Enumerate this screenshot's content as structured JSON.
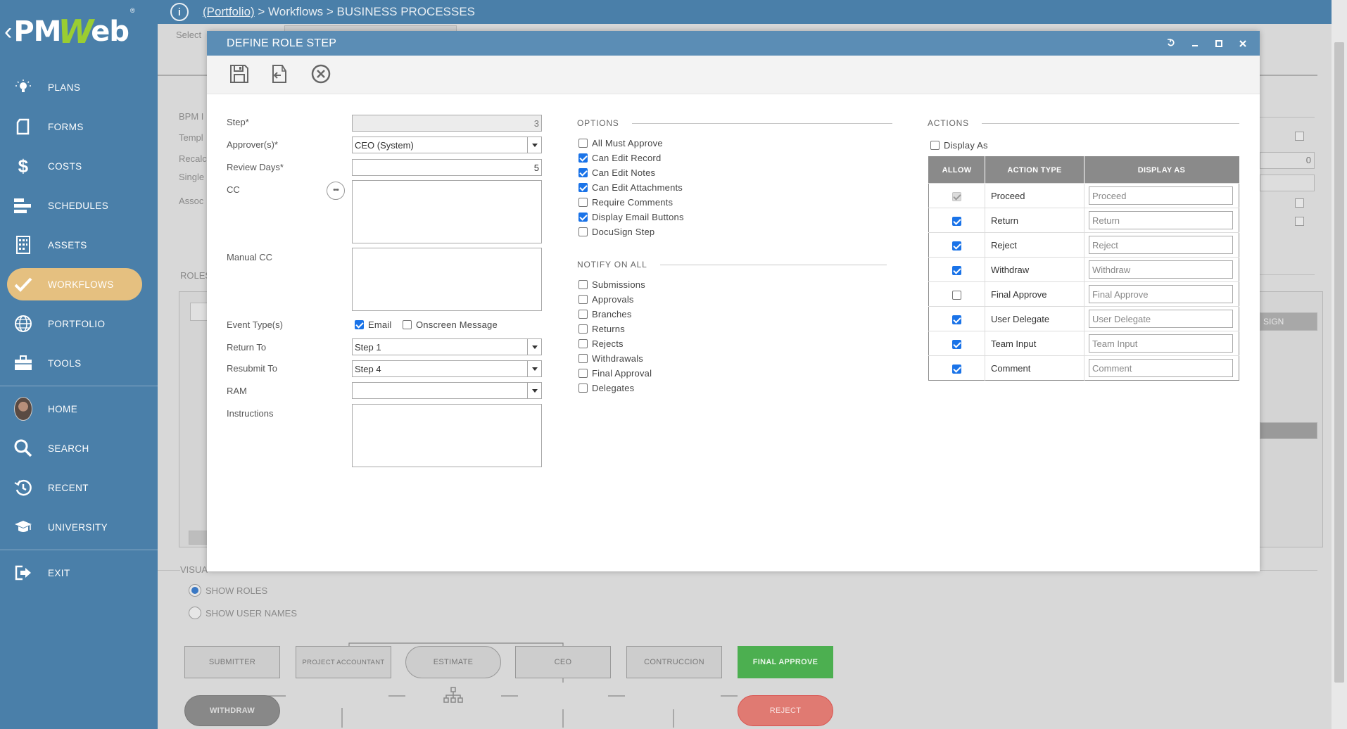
{
  "app": {
    "logo_text_left": "PM",
    "logo_text_mid": "W",
    "logo_text_right": "eb",
    "logo_reg": "®"
  },
  "sidebar": {
    "items": [
      {
        "label": "PLANS",
        "icon": "lightbulb-icon"
      },
      {
        "label": "FORMS",
        "icon": "document-icon"
      },
      {
        "label": "COSTS",
        "icon": "dollar-icon"
      },
      {
        "label": "SCHEDULES",
        "icon": "schedule-bars-icon"
      },
      {
        "label": "ASSETS",
        "icon": "building-icon"
      },
      {
        "label": "WORKFLOWS",
        "icon": "checkmark-icon",
        "active": true
      },
      {
        "label": "PORTFOLIO",
        "icon": "globe-icon"
      },
      {
        "label": "TOOLS",
        "icon": "briefcase-icon"
      },
      {
        "label": "HOME",
        "icon": "avatar"
      },
      {
        "label": "SEARCH",
        "icon": "search-icon"
      },
      {
        "label": "RECENT",
        "icon": "history-icon"
      },
      {
        "label": "UNIVERSITY",
        "icon": "graduation-cap-icon"
      },
      {
        "label": "EXIT",
        "icon": "exit-icon"
      }
    ],
    "active_color": "#e5c080",
    "bg_color": "#4a7fa9"
  },
  "topbar": {
    "portfolio_link": "(Portfolio)",
    "crumb_rest": " > Workflows > BUSINESS PROCESSES"
  },
  "background": {
    "select_label": "Select",
    "bpm_label": "BPM I",
    "templ_label": "Templ",
    "recalc_label": "Recalc",
    "single_label": "Single",
    "assoc_label": "Assoc",
    "roles_label": "ROLES",
    "visual_label": "VISUA",
    "right_value": "0",
    "sign_header": "SIGN",
    "show_roles": "SHOW ROLES",
    "show_user_names": "SHOW USER NAMES",
    "workflow": {
      "submitter": "SUBMITTER",
      "project_accountant": "PROJECT ACCOUNTANT",
      "estimate": "ESTIMATE",
      "ceo": "CEO",
      "contruccion": "CONTRUCCION",
      "final_approve": "FINAL APPROVE",
      "withdraw": "WITHDRAW",
      "reject": "REJECT"
    }
  },
  "modal": {
    "title": "DEFINE ROLE STEP",
    "form": {
      "step_label": "Step*",
      "step_value": "3",
      "approvers_label": "Approver(s)*",
      "approvers_value": "CEO (System)",
      "review_days_label": "Review Days*",
      "review_days_value": "5",
      "cc_label": "CC",
      "cc_button": "•••",
      "manual_cc_label": "Manual CC",
      "event_types_label": "Event Type(s)",
      "event_email": "Email",
      "event_onscreen": "Onscreen Message",
      "return_to_label": "Return To",
      "return_to_value": "Step 1",
      "resubmit_to_label": "Resubmit To",
      "resubmit_to_value": "Step 4",
      "ram_label": "RAM",
      "ram_value": "",
      "instructions_label": "Instructions"
    },
    "options": {
      "title": "OPTIONS",
      "items": [
        {
          "label": "All Must Approve",
          "checked": false
        },
        {
          "label": "Can Edit Record",
          "checked": true
        },
        {
          "label": "Can Edit Notes",
          "checked": true
        },
        {
          "label": "Can Edit Attachments",
          "checked": true
        },
        {
          "label": "Require Comments",
          "checked": false
        },
        {
          "label": "Display Email Buttons",
          "checked": true
        },
        {
          "label": "DocuSign Step",
          "checked": false
        }
      ]
    },
    "notify": {
      "title": "NOTIFY ON ALL",
      "items": [
        {
          "label": "Submissions",
          "checked": false
        },
        {
          "label": "Approvals",
          "checked": false
        },
        {
          "label": "Branches",
          "checked": false
        },
        {
          "label": "Returns",
          "checked": false
        },
        {
          "label": "Rejects",
          "checked": false
        },
        {
          "label": "Withdrawals",
          "checked": false
        },
        {
          "label": "Final Approval",
          "checked": false
        },
        {
          "label": "Delegates",
          "checked": false
        }
      ]
    },
    "actions": {
      "title": "ACTIONS",
      "display_as_label": "Display As",
      "columns": [
        "ALLOW",
        "ACTION TYPE",
        "DISPLAY AS"
      ],
      "rows": [
        {
          "allow": "disabled",
          "type": "Proceed",
          "display": "Proceed"
        },
        {
          "allow": "on",
          "type": "Return",
          "display": "Return"
        },
        {
          "allow": "on",
          "type": "Reject",
          "display": "Reject"
        },
        {
          "allow": "on",
          "type": "Withdraw",
          "display": "Withdraw"
        },
        {
          "allow": "off",
          "type": "Final Approve",
          "display": "Final Approve"
        },
        {
          "allow": "on",
          "type": "User Delegate",
          "display": "User Delegate"
        },
        {
          "allow": "on",
          "type": "Team Input",
          "display": "Team Input"
        },
        {
          "allow": "on",
          "type": "Comment",
          "display": "Comment"
        }
      ]
    }
  }
}
